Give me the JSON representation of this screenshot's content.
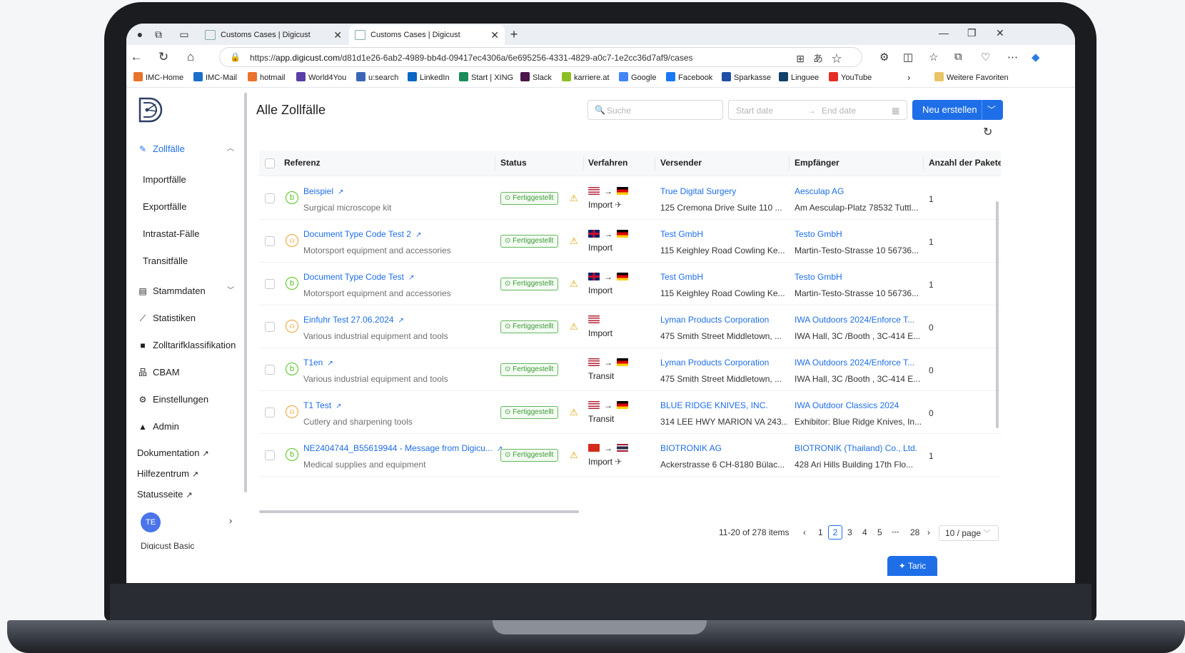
{
  "browser": {
    "tabs": [
      {
        "title": "Customs Cases | Digicust"
      },
      {
        "title": "Customs Cases | Digicust"
      }
    ],
    "url_prefix": "https://",
    "url_host": "app.digicust.com",
    "url_path": "/d81d1e26-6ab2-4989-bb4d-09417ec4306a/6e695256-4331-4829-a0c7-1e2cc36d7af9/cases",
    "bookmarks": [
      {
        "label": "IMC-Home",
        "color": "#e8732c"
      },
      {
        "label": "IMC-Mail",
        "color": "#1b6fc9"
      },
      {
        "label": "hotmail",
        "color": "#e8732c"
      },
      {
        "label": "World4You",
        "color": "#5a3ea6"
      },
      {
        "label": "u:search",
        "color": "#3a66b5"
      },
      {
        "label": "LinkedIn",
        "color": "#0a66c2"
      },
      {
        "label": "Start | XING",
        "color": "#1b8c5a"
      },
      {
        "label": "Slack",
        "color": "#4a154b"
      },
      {
        "label": "karriere.at",
        "color": "#8cbf26"
      },
      {
        "label": "Google",
        "color": "#4285f4"
      },
      {
        "label": "Facebook",
        "color": "#1877f2"
      },
      {
        "label": "Sparkasse",
        "color": "#1e4ea8"
      },
      {
        "label": "Linguee",
        "color": "#10416b"
      },
      {
        "label": "YouTube",
        "color": "#e52d27"
      }
    ],
    "bookmark_more": "Weitere Favoriten"
  },
  "sidebar": {
    "group_zollfaelle": "Zollfälle",
    "sub_items": [
      "Importfälle",
      "Exportfälle",
      "Intrastat-Fälle",
      "Transitfälle"
    ],
    "items": [
      {
        "label": "Stammdaten",
        "icon": "database-icon"
      },
      {
        "label": "Statistiken",
        "icon": "chart-line-icon"
      },
      {
        "label": "Zolltarifklassifikation",
        "icon": "book-icon"
      },
      {
        "label": "CBAM",
        "icon": "sitemap-icon"
      },
      {
        "label": "Einstellungen",
        "icon": "gear-icon"
      },
      {
        "label": "Admin",
        "icon": "lock-icon"
      }
    ],
    "links": [
      "Dokumentation",
      "Hilfezentrum",
      "Statusseite"
    ],
    "avatar": "TE",
    "bottom_text": "Digicust Basic"
  },
  "main": {
    "title": "Alle Zollfälle",
    "search_placeholder": "Suche",
    "start_date": "Start date",
    "end_date": "End date",
    "new_button": "Neu erstellen",
    "columns": [
      "Referenz",
      "Status",
      "Verfahren",
      "Versender",
      "Empfänger",
      "Anzahl der Pakete"
    ],
    "rows": [
      {
        "badge": "b",
        "badge_color": "#52c41a",
        "ref": "Beispiel",
        "desc": "Surgical microscope kit",
        "status": "Fertiggestellt",
        "warn": true,
        "from": "us",
        "to": "de",
        "proc": "Import",
        "plane": true,
        "sender": "True Digital Surgery",
        "sender_addr": "125 Cremona Drive Suite 110 ...",
        "recipient": "Aesculap AG",
        "recipient_addr": "Am Aesculap-Platz 78532 Tuttl...",
        "count": "1"
      },
      {
        "badge": "user",
        "badge_color": "#f0a030",
        "ref": "Document Type Code Test 2",
        "desc": "Motorsport equipment and accessories",
        "status": "Fertiggestellt",
        "warn": true,
        "from": "gb",
        "to": "de",
        "proc": "Import",
        "plane": false,
        "sender": "Test GmbH",
        "sender_addr": "115 Keighley Road Cowling Ke...",
        "recipient": "Testo GmbH",
        "recipient_addr": "Martin-Testo-Strasse 10 56736...",
        "count": "1"
      },
      {
        "badge": "b",
        "badge_color": "#52c41a",
        "ref": "Document Type Code Test",
        "desc": "Motorsport equipment and accessories",
        "status": "Fertiggestellt",
        "warn": true,
        "from": "gb",
        "to": "de",
        "proc": "Import",
        "plane": false,
        "sender": "Test GmbH",
        "sender_addr": "115 Keighley Road Cowling Ke...",
        "recipient": "Testo GmbH",
        "recipient_addr": "Martin-Testo-Strasse 10 56736...",
        "count": "1"
      },
      {
        "badge": "user",
        "badge_color": "#f0a030",
        "ref": "Einfuhr Test 27.06.2024",
        "desc": "Various industrial equipment and tools",
        "status": "Fertiggestellt",
        "warn": true,
        "from": "us",
        "to": "",
        "proc": "Import",
        "plane": false,
        "sender": "Lyman Products Corporation",
        "sender_addr": "475 Smith Street Middletown, ...",
        "recipient": "IWA Outdoors 2024/Enforce T...",
        "recipient_addr": "IWA Hall, 3C /Booth , 3C-414 E...",
        "count": "0"
      },
      {
        "badge": "b",
        "badge_color": "#52c41a",
        "ref": "T1en",
        "desc": "Various industrial equipment and tools",
        "status": "Fertiggestellt",
        "warn": false,
        "from": "us",
        "to": "de",
        "proc": "Transit",
        "plane": false,
        "sender": "Lyman Products Corporation",
        "sender_addr": "475 Smith Street Middletown, ...",
        "recipient": "IWA Outdoors 2024/Enforce T...",
        "recipient_addr": "IWA Hall, 3C /Booth , 3C-414 E...",
        "count": "0"
      },
      {
        "badge": "user",
        "badge_color": "#f0a030",
        "ref": "T1 Test",
        "desc": "Cutlery and sharpening tools",
        "status": "Fertiggestellt",
        "warn": true,
        "from": "us",
        "to": "de",
        "proc": "Transit",
        "plane": false,
        "sender": "BLUE RIDGE KNIVES, INC.",
        "sender_addr": "314 LEE HWY MARION VA 243...",
        "recipient": "IWA Outdoor Classics 2024",
        "recipient_addr": "Exhibitor: Blue Ridge Knives, In...",
        "count": "0"
      },
      {
        "badge": "b",
        "badge_color": "#52c41a",
        "ref": "NE2404744_B55619944 - Message from Digicu...",
        "desc": "Medical supplies and equipment",
        "status": "Fertiggestellt",
        "warn": true,
        "from": "ch",
        "to": "th",
        "proc": "Import",
        "plane": true,
        "sender": "BIOTRONIK AG",
        "sender_addr": "Ackerstrasse 6 CH-8180 Bülac...",
        "recipient": "BIOTRONIK (Thailand) Co., Ltd.",
        "recipient_addr": "428 Ari Hills Building 17th Flo...",
        "count": "1"
      }
    ],
    "pagination": {
      "summary": "11-20 of 278 items",
      "pages": [
        "1",
        "2",
        "3",
        "4",
        "5",
        "•••",
        "28"
      ],
      "current": "2",
      "page_size": "10 / page"
    },
    "taric_button": "Taric"
  }
}
